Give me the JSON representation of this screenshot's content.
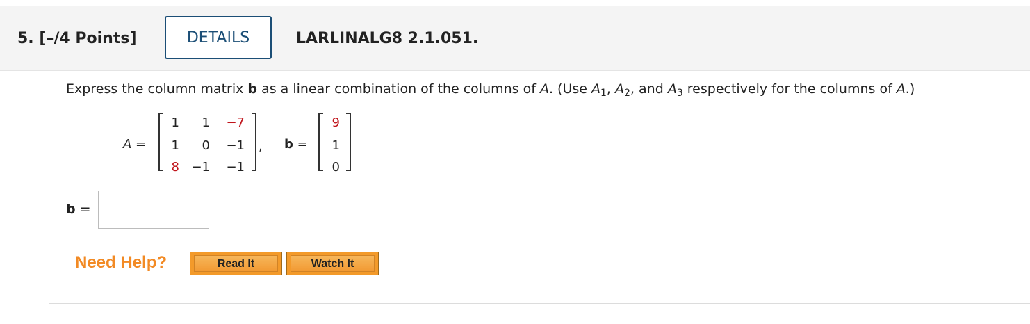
{
  "header": {
    "question_number": "5.",
    "points": "[–/4 Points]",
    "details_label": "DETAILS",
    "problem_code": "LARLINALG8 2.1.051."
  },
  "prompt": {
    "part1": "Express the column matrix ",
    "b": "b",
    "part2": " as a linear combination of the columns of ",
    "A": "A",
    "part3": ". (Use ",
    "A1": "A",
    "s1": "1",
    "sep1": ", ",
    "A2": "A",
    "s2": "2",
    "sep2": ", and ",
    "A3": "A",
    "s3": "3",
    "part4": " respectively for the columns of ",
    "A_end": "A",
    "part5": ".)"
  },
  "matrix_A": {
    "label": "A =",
    "rows": [
      [
        "1",
        "1",
        "−7"
      ],
      [
        "1",
        "0",
        "−1"
      ],
      [
        "8",
        "−1",
        "−1"
      ]
    ],
    "separator": ","
  },
  "vector_b": {
    "label_b": "b",
    "label_eq": "=",
    "values": [
      "9",
      "1",
      "0"
    ]
  },
  "answer": {
    "label_b": "b",
    "label_eq": "=",
    "value": "",
    "placeholder": ""
  },
  "help": {
    "title": "Need Help?",
    "read_it": "Read It",
    "watch_it": "Watch It"
  },
  "colors": {
    "header_bg": "#f4f4f4",
    "details_border": "#1b4e76",
    "highlight_red": "#c0141b",
    "need_help_orange": "#f28a24",
    "button_orange": "#f39a2a"
  }
}
